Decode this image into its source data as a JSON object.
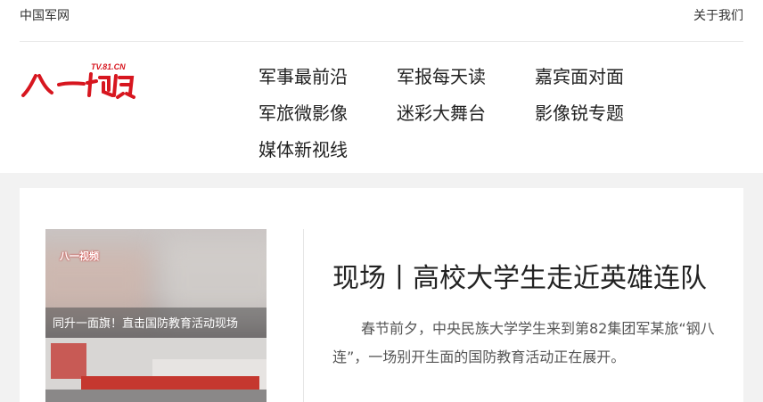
{
  "topbar": {
    "site_name": "中国军网",
    "about_link": "关于我们"
  },
  "logo": {
    "text": "八一视频",
    "sub": "TV.81.CN",
    "color": "#d7161f"
  },
  "nav": {
    "items": [
      {
        "label": "军事最前沿"
      },
      {
        "label": "军报每天读"
      },
      {
        "label": "嘉宾面对面"
      },
      {
        "label": "军旅微影像"
      },
      {
        "label": "迷彩大舞台"
      },
      {
        "label": "影像锐专题"
      },
      {
        "label": "媒体新视线"
      }
    ]
  },
  "feature": {
    "thumb_logo": "八一视频",
    "thumb_caption": "同升一面旗！直击国防教育活动现场",
    "headline": "现场丨高校大学生走近英雄连队",
    "summary": "春节前夕，中央民族大学学生来到第82集团军某旅“钢八连”，一场别开生面的国防教育活动正在展开。"
  }
}
